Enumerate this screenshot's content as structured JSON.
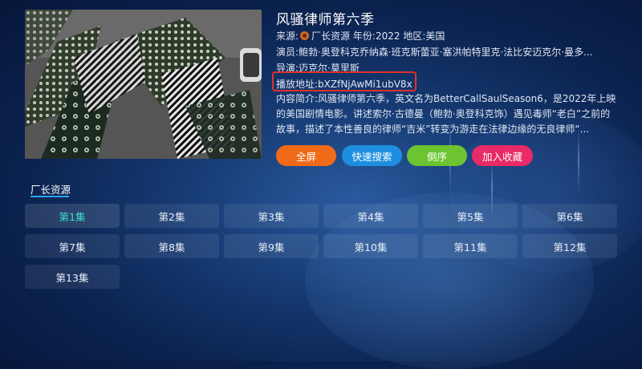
{
  "show": {
    "title": "风骚律师第六季",
    "source_label": "来源:",
    "source_name": "厂长资源",
    "year_label": "年份:",
    "year": "2022",
    "region_label": "地区:",
    "region": "美国",
    "actors_label": "演员:",
    "actors": "鲍勃·奥登科克乔纳森·班克斯蕾亚·塞洪帕特里克·法比安迈克尔·曼多...",
    "director_label": "导演:",
    "director": "迈克尔·莫里斯",
    "play_label": "播放地址:",
    "play_address": "bXZfNjAwMi1ubV8x",
    "desc_label": "内容简介:",
    "description": "风骚律师第六季，英文名为BetterCallSaulSeason6，是2022年上映的美国剧情电影。讲述索尔·古德曼（鲍勃·奥登科克饰）遇见毒师“老白”之前的故事，描述了本性善良的律师“吉米”转变为游走在法律边缘的无良律师“..."
  },
  "actions": {
    "fullscreen": "全屏",
    "quick_search": "快速搜索",
    "reverse": "倒序",
    "add_favorite": "加入收藏"
  },
  "source_tab": "厂长资源",
  "episodes": [
    "第1集",
    "第2集",
    "第3集",
    "第4集",
    "第5集",
    "第6集",
    "第7集",
    "第8集",
    "第9集",
    "第10集",
    "第11集",
    "第12集",
    "第13集"
  ],
  "active_episode": "第1集",
  "colors": {
    "fullscreen": "#f06a18",
    "quick_search": "#1e8fe0",
    "reverse": "#6cc431",
    "add_favorite": "#e82a66",
    "active_episode_text": "#3ee0c8",
    "highlight_box": "#e0302a"
  }
}
